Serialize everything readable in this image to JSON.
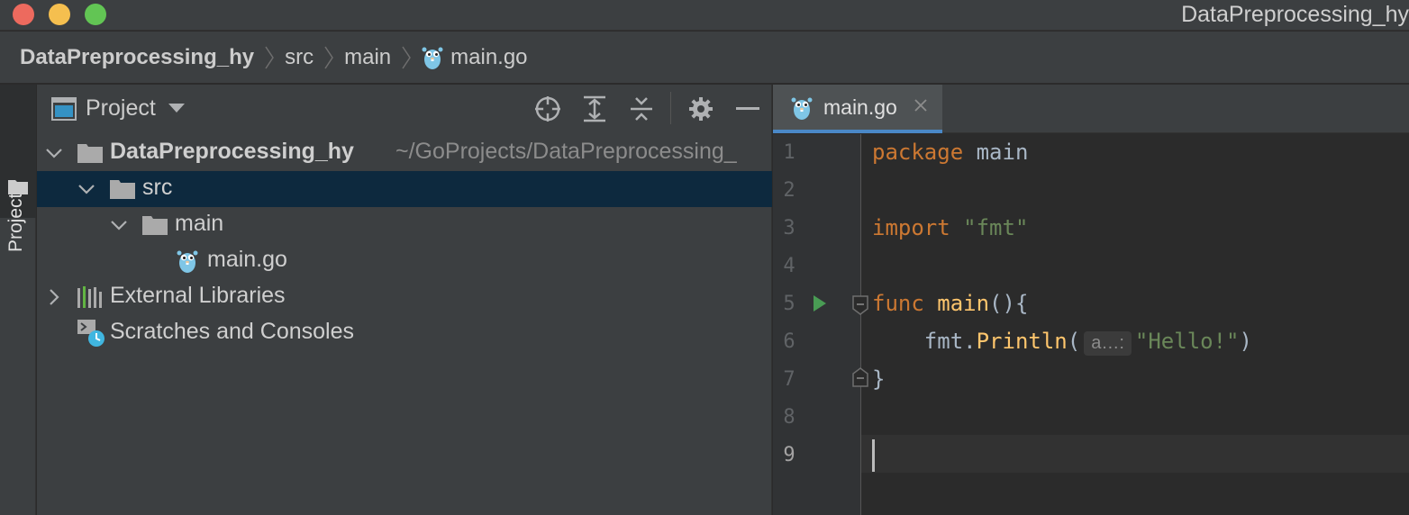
{
  "window": {
    "title": "DataPreprocessing_hy"
  },
  "breadcrumb": {
    "items": [
      "DataPreprocessing_hy",
      "src",
      "main",
      "main.go"
    ]
  },
  "stripe": {
    "label": "Project"
  },
  "project_panel": {
    "title": "Project",
    "tools": [
      "locate-icon",
      "expand-all-icon",
      "collapse-all-icon",
      "gear-icon",
      "minimize-icon"
    ]
  },
  "tree": {
    "root_name": "DataPreprocessing_hy",
    "root_path": "~/GoProjects/DataPreprocessing_",
    "src": "src",
    "main": "main",
    "main_go": "main.go",
    "external": "External Libraries",
    "scratches": "Scratches and Consoles"
  },
  "editor": {
    "tab_label": "main.go",
    "line_numbers": [
      "1",
      "2",
      "3",
      "4",
      "5",
      "6",
      "7",
      "8",
      "9"
    ],
    "current_line": 9,
    "code": {
      "l1_kw": "package",
      "l1_name": " main",
      "l3_kw": "import",
      "l3_str": " \"fmt\"",
      "l5_kw": "func",
      "l5_fn": " main",
      "l5_rest": "(){",
      "l6_pre": "    fmt.",
      "l6_fn": "Println",
      "l6_open": "(",
      "l6_hint": "a…:",
      "l6_str": "\"Hello!\"",
      "l6_close": ")",
      "l7": "}"
    }
  },
  "colors": {
    "accent": "#4a88c7",
    "selection": "#0d293e",
    "keyword": "#cc7832",
    "string": "#6a8759",
    "function": "#ffc66d",
    "run": "#499c54"
  }
}
